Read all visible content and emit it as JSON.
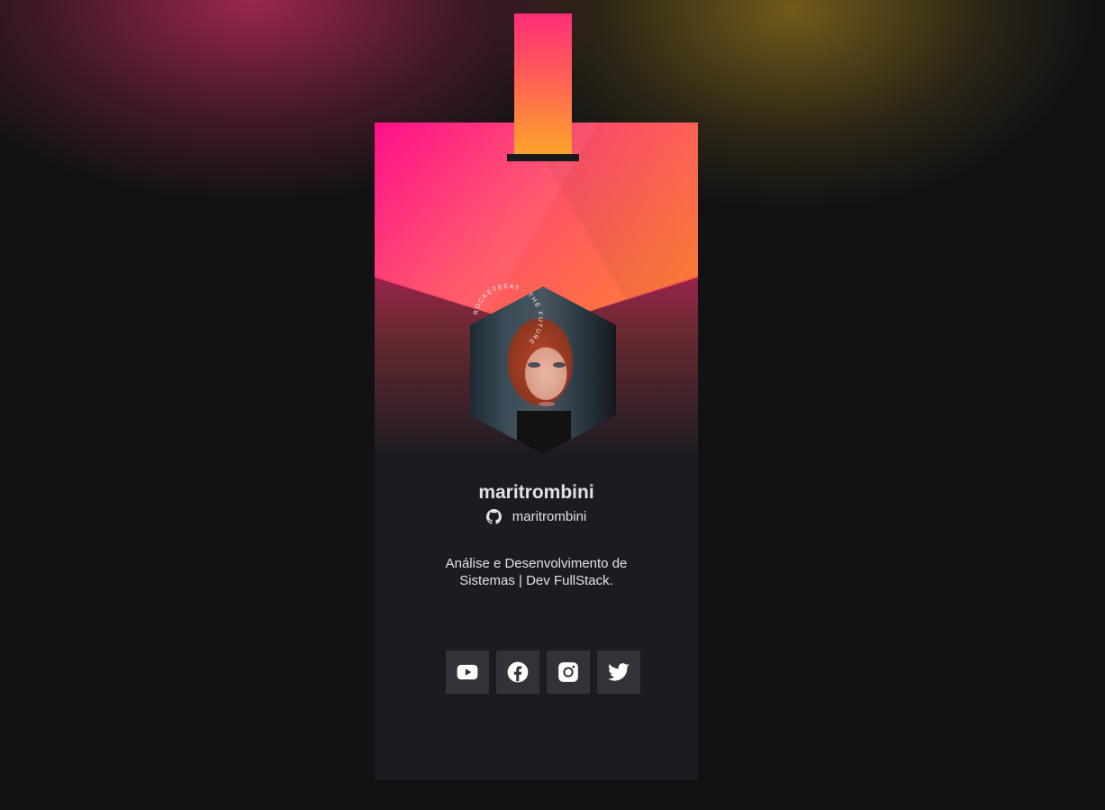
{
  "profile": {
    "name": "maritrombini",
    "github_username": "maritrombini",
    "bio": "Análise e Desenvolvimento de Sistemas | Dev FullStack.",
    "avatar_badge_text": "ROCKETSEAT · THE FUTURE"
  },
  "social_links": [
    {
      "name": "youtube",
      "icon": "youtube-icon"
    },
    {
      "name": "facebook",
      "icon": "facebook-icon"
    },
    {
      "name": "instagram",
      "icon": "instagram-icon"
    },
    {
      "name": "twitter",
      "icon": "twitter-icon"
    }
  ],
  "colors": {
    "background": "#121214",
    "card": "#1c1b21",
    "gradient_start": "#ff0f8a",
    "gradient_end": "#ffa21e",
    "button": "#323238",
    "text": "#e1e1e6"
  }
}
